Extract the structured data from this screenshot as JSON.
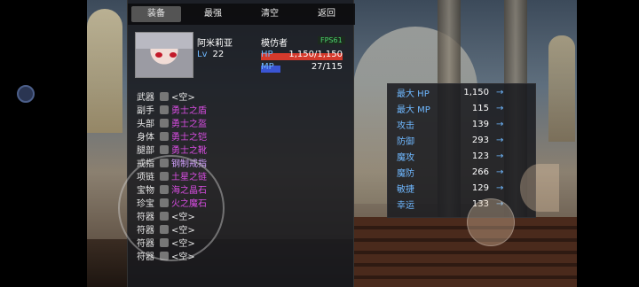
{
  "tabs": [
    "装备",
    "最强",
    "清空",
    "返回"
  ],
  "character": {
    "name": "阿米莉亚",
    "level_label": "Lv",
    "level": "22",
    "class": "模仿者",
    "fps": "FPS61",
    "hp_label": "HP",
    "hp_value": "1,150/1,150",
    "mp_label": "MP",
    "mp_value": "27/115"
  },
  "equipment": [
    {
      "slot": "武器",
      "item": "<空>",
      "type": "empty",
      "icon": "empty-slot-icon"
    },
    {
      "slot": "副手",
      "item": "勇士之盾",
      "type": "item",
      "icon": "shield-icon"
    },
    {
      "slot": "头部",
      "item": "勇士之盔",
      "type": "item",
      "icon": "helmet-icon"
    },
    {
      "slot": "身体",
      "item": "勇士之铠",
      "type": "item",
      "icon": "armor-icon"
    },
    {
      "slot": "腿部",
      "item": "勇士之靴",
      "type": "item",
      "icon": "boots-icon"
    },
    {
      "slot": "戒指",
      "item": "钢制戒指",
      "type": "special",
      "icon": "ring-icon"
    },
    {
      "slot": "项链",
      "item": "土星之链",
      "type": "item",
      "icon": "necklace-icon"
    },
    {
      "slot": "宝物",
      "item": "海之晶石",
      "type": "item",
      "icon": "gem-icon"
    },
    {
      "slot": "珍宝",
      "item": "火之魔石",
      "type": "item",
      "icon": "fire-stone-icon"
    },
    {
      "slot": "符器",
      "item": "<空>",
      "type": "empty",
      "icon": "empty-slot-icon"
    },
    {
      "slot": "符器",
      "item": "<空>",
      "type": "empty",
      "icon": "empty-slot-icon"
    },
    {
      "slot": "符器",
      "item": "<空>",
      "type": "empty",
      "icon": "empty-slot-icon"
    },
    {
      "slot": "符器",
      "item": "<空>",
      "type": "empty",
      "icon": "empty-slot-icon"
    }
  ],
  "stats": [
    {
      "name": "最大 HP",
      "value": "1,150"
    },
    {
      "name": "最大 MP",
      "value": "115"
    },
    {
      "name": "攻击",
      "value": "139"
    },
    {
      "name": "防御",
      "value": "293"
    },
    {
      "name": "魔攻",
      "value": "123"
    },
    {
      "name": "魔防",
      "value": "266"
    },
    {
      "name": "敏捷",
      "value": "129"
    },
    {
      "name": "幸运",
      "value": "133"
    }
  ],
  "arrow": "→",
  "hp_fraction": 1.0,
  "mp_fraction": 0.235,
  "colors": {
    "panel": "#181a1e",
    "label_blue": "#6fb8ff",
    "item_pink": "#d94de3",
    "hp_red": "#d43a2c",
    "mp_blue": "#3a55d4"
  }
}
